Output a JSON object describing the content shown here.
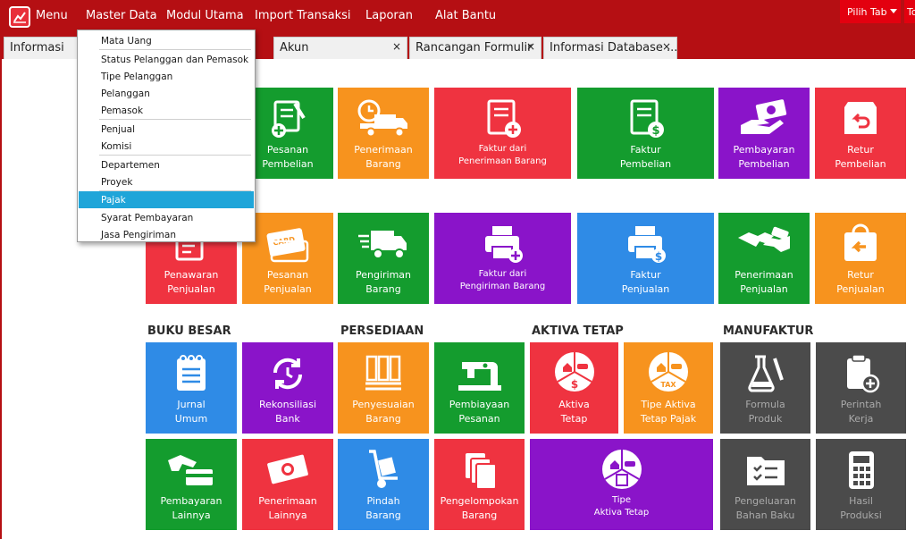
{
  "menubar": {
    "menu_label": "Menu",
    "items": [
      "Master Data",
      "Modul Utama",
      "Import Transaksi",
      "Laporan",
      "Alat Bantu"
    ],
    "pilih_tab": "Pilih Tab",
    "extra_button": "To"
  },
  "tabs": [
    {
      "label": "Informasi",
      "closable": false
    },
    {
      "label": "Akun",
      "closable": true
    },
    {
      "label": "Rancangan Formulir",
      "closable": true
    },
    {
      "label": "Informasi Database ...",
      "closable": true
    }
  ],
  "close_glyph": "×",
  "dropdown": {
    "items": [
      "Mata Uang",
      "Status Pelanggan dan Pemasok",
      "Tipe Pelanggan",
      "Pelanggan",
      "Pemasok",
      "Penjual",
      "Komisi",
      "Departemen",
      "Proyek",
      "Pajak",
      "Syarat Pembayaran",
      "Jasa Pengiriman"
    ],
    "selected": "Pajak"
  },
  "sections": {
    "buku_besar": "BUKU BESAR",
    "persediaan": "PERSEDIAAN",
    "aktiva_tetap": "AKTIVA TETAP",
    "manufaktur": "MANUFAKTUR"
  },
  "tiles": {
    "pesanan_pembelian": "Pesanan\nPembelian",
    "penerimaan_barang": "Penerimaan\nBarang",
    "faktur_penerimaan": "Faktur dari\nPenerimaan Barang",
    "faktur_pembelian": "Faktur\nPembelian",
    "pembayaran_pembelian": "Pembayaran\nPembelian",
    "retur_pembelian": "Retur\nPembelian",
    "penawaran_penjualan": "Penawaran\nPenjualan",
    "pesanan_penjualan": "Pesanan\nPenjualan",
    "pengiriman_barang": "Pengiriman\nBarang",
    "faktur_pengiriman": "Faktur dari\nPengiriman Barang",
    "faktur_penjualan": "Faktur\nPenjualan",
    "penerimaan_penjualan": "Penerimaan\nPenjualan",
    "retur_penjualan": "Retur\nPenjualan",
    "jurnal_umum": "Jurnal\nUmum",
    "rekonsiliasi_bank": "Rekonsiliasi\nBank",
    "penyesuaian_barang": "Penyesuaian\nBarang",
    "pembiayaan_pesanan": "Pembiayaan\nPesanan",
    "aktiva_tetap": "Aktiva\nTetap",
    "tipe_aktiva_pajak": "Tipe Aktiva\nTetap Pajak",
    "formula_produk": "Formula\nProduk",
    "perintah_kerja": "Perintah\nKerja",
    "pembayaran_lainnya": "Pembayaran\nLainnya",
    "penerimaan_lainnya": "Penerimaan\nLainnya",
    "pindah_barang": "Pindah\nBarang",
    "pengelompokan_barang": "Pengelompokan\nBarang",
    "tipe_aktiva_tetap": "Tipe\nAktiva Tetap",
    "pengeluaran_bahan_baku": "Pengeluaran\nBahan Baku",
    "hasil_produksi": "Hasil\nProduksi"
  },
  "icon_texts": {
    "card": "CARD",
    "tax": "TAX",
    "dollar": "$"
  },
  "colors": {
    "menubar": "#b50f13",
    "green": "#149c2e",
    "orange": "#f7931e",
    "red": "#ef3340",
    "purple": "#8a14c9",
    "blue": "#2f8be6",
    "gray": "#4b4b4b",
    "selected": "#1fa5d9"
  }
}
